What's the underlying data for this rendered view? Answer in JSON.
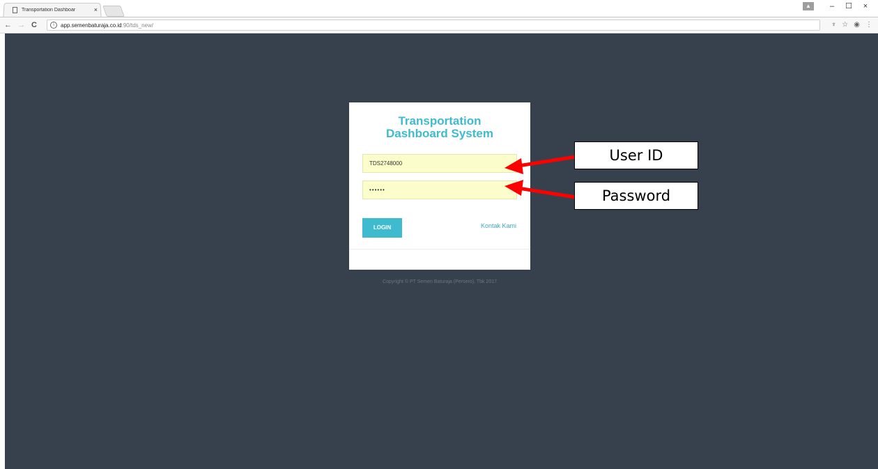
{
  "browser": {
    "tab_title": "Transportation Dashboar",
    "tab_close": "×",
    "url_host": "app.semenbaturaja.co.id",
    "url_path": ":90/tds_new/",
    "nav_back": "←",
    "nav_forward": "→",
    "nav_reload": "C",
    "info_glyph": "i",
    "window_minimize": "–",
    "window_restore": "☐",
    "window_close": "×"
  },
  "login": {
    "title_line1": "Transportation",
    "title_line2": "Dashboard System",
    "userid_value": "TDS2748000",
    "password_value": "••••••",
    "login_button": "LOGIN",
    "contact_link": "Kontak Kami",
    "copyright": "Copyright © PT Semen Baturaja (Persero), Tbk 2017"
  },
  "annotations": {
    "userid_label": "User ID",
    "password_label": "Password",
    "arrow_color": "#ff0000"
  },
  "colors": {
    "page_background": "#37414e",
    "accent": "#3fbbcf",
    "field_background": "#fbfdcb"
  }
}
